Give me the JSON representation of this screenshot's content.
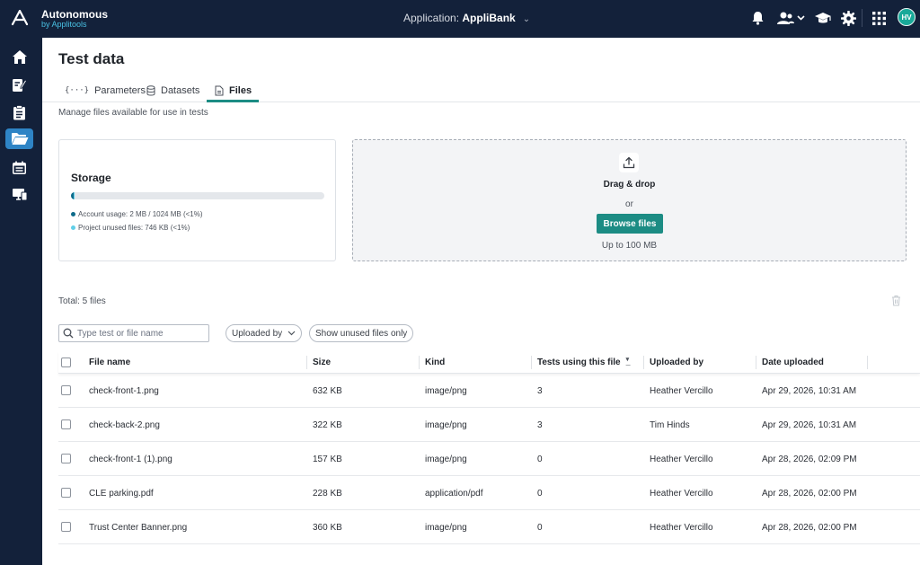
{
  "brand": {
    "name": "Autonomous",
    "sub": "by Applitools"
  },
  "header": {
    "app_prefix": "Application: ",
    "app_name": "AppliBank",
    "avatar_initials": "HV"
  },
  "sidebar": {
    "items": [
      {
        "icon": "home-icon"
      },
      {
        "icon": "test-edit-icon"
      },
      {
        "icon": "clipboard-icon"
      },
      {
        "icon": "folder-open-icon",
        "active": true
      },
      {
        "icon": "calendar-icon"
      },
      {
        "icon": "devices-icon"
      }
    ]
  },
  "page": {
    "title": "Test data",
    "tabs": [
      {
        "label": "Parameters",
        "icon": "braces-icon"
      },
      {
        "label": "Datasets",
        "icon": "database-icon"
      },
      {
        "label": "Files",
        "icon": "file-icon",
        "active": true
      }
    ],
    "subtitle": "Manage files available for use in tests"
  },
  "storage": {
    "title": "Storage",
    "account_fraction": 0.002,
    "unused_fraction": 0.0007,
    "account_label": "Account usage: 2 MB / 1024 MB (<1%)",
    "unused_label": "Project unused files: 746 KB (<1%)",
    "colors": {
      "account": "#0e6b8a",
      "unused": "#61cfe8"
    }
  },
  "upload": {
    "title": "Drag & drop",
    "or": "or",
    "button": "Browse files",
    "limit": "Up to 100 MB"
  },
  "list": {
    "total": "Total: 5 files",
    "search_placeholder": "Type test or file name",
    "filter_uploaded_by": "Uploaded by",
    "filter_unused": "Show unused files only",
    "columns": {
      "name": "File name",
      "size": "Size",
      "kind": "Kind",
      "tests": "Tests using this file",
      "uploaded_by": "Uploaded by",
      "date": "Date uploaded"
    },
    "rows": [
      {
        "name": "check-front-1.png",
        "size": "632 KB",
        "kind": "image/png",
        "tests": "3",
        "uploaded_by": "Heather Vercillo",
        "date": "Apr 29, 2026, 10:31 AM"
      },
      {
        "name": "check-back-2.png",
        "size": "322 KB",
        "kind": "image/png",
        "tests": "3",
        "uploaded_by": "Tim Hinds",
        "date": "Apr 29, 2026, 10:31 AM"
      },
      {
        "name": "check-front-1 (1).png",
        "size": "157 KB",
        "kind": "image/png",
        "tests": "0",
        "uploaded_by": "Heather Vercillo",
        "date": "Apr 28, 2026, 02:09 PM"
      },
      {
        "name": "CLE parking.pdf",
        "size": "228 KB",
        "kind": "application/pdf",
        "tests": "0",
        "uploaded_by": "Heather Vercillo",
        "date": "Apr 28, 2026, 02:00 PM"
      },
      {
        "name": "Trust Center Banner.png",
        "size": "360 KB",
        "kind": "image/png",
        "tests": "0",
        "uploaded_by": "Heather Vercillo",
        "date": "Apr 28, 2026, 02:00 PM"
      }
    ]
  },
  "colors": {
    "navy": "#13213a",
    "accent": "#1c8c84",
    "active_nav": "#2e84c5"
  }
}
